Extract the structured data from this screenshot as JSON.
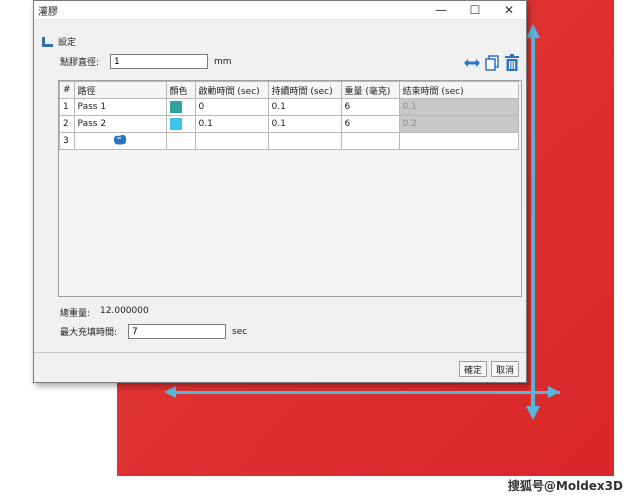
{
  "window": {
    "title": "灌膠",
    "min": "—",
    "max": "☐",
    "close": "✕"
  },
  "section": {
    "label": "設定"
  },
  "diameter": {
    "label": "點膠直徑:",
    "value": "1",
    "unit": "mm"
  },
  "toolbar": {
    "icons": [
      "swap-arrows-icon",
      "copy-icon",
      "trash-icon"
    ]
  },
  "grid": {
    "columns": [
      "#",
      "路徑",
      "顏色",
      "啟動時間 (sec)",
      "持續時間 (sec)",
      "重量 (毫克)",
      "結束時間 (sec)"
    ],
    "rows": [
      {
        "num": "1",
        "path": "Pass 1",
        "color": "#2ca39b",
        "start": "0",
        "duration": "0.1",
        "weight": "6",
        "end": "0.1"
      },
      {
        "num": "2",
        "path": "Pass 2",
        "color": "#3cc3ea",
        "start": "0.1",
        "duration": "0.1",
        "weight": "6",
        "end": "0.2"
      },
      {
        "num": "3",
        "path": "",
        "color": "",
        "start": "",
        "duration": "",
        "weight": "",
        "end": ""
      }
    ]
  },
  "total": {
    "label": "總重量:",
    "value": "12.000000"
  },
  "maxfill": {
    "label": "最大充填時間:",
    "value": "7",
    "unit": "sec"
  },
  "buttons": {
    "ok": "確定",
    "cancel": "取消"
  },
  "watermark": "搜狐号@Moldex3D",
  "colors": {
    "axis": "#56b8dc",
    "background_red": "#dd2f2f",
    "accent_blue": "#2b74c0"
  }
}
